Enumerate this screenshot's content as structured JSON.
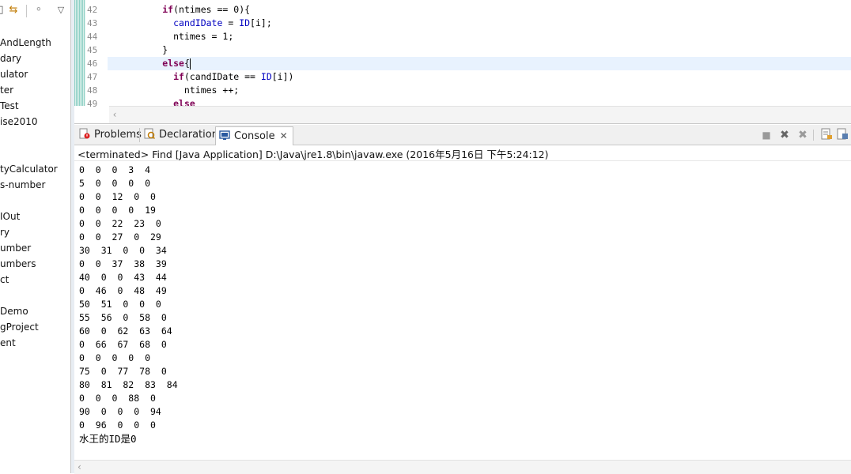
{
  "left_panel": {
    "toolbar_icons": [
      "link-with-editor-icon",
      "sync-arrows-icon",
      "filter-icon",
      "view-menu-icon"
    ],
    "items": [
      "AndLength",
      "dary",
      "ulator",
      "ter",
      "Test",
      "ise2010",
      "",
      "",
      "tyCalculator",
      "s-number",
      "",
      "IOut",
      "ry",
      "umber",
      "umbers",
      "ct",
      "",
      "Demo",
      "gProject",
      "ent"
    ]
  },
  "editor": {
    "line_numbers": [
      "42",
      "43",
      "44",
      "45",
      "46",
      "47",
      "48",
      "49"
    ]
  },
  "tabs": {
    "problems": "Problems",
    "declaration": "Declaration",
    "console": "Console"
  },
  "console": {
    "title": "<terminated> Find [Java Application] D:\\Java\\jre1.8\\bin\\javaw.exe (2016年5月16日 下午5:24:12)",
    "lines": [
      "0  0  0  3  4",
      "5  0  0  0  0",
      "0  0  12  0  0",
      "0  0  0  0  19",
      "0  0  22  23  0",
      "0  0  27  0  29",
      "30  31  0  0  34",
      "0  0  37  38  39",
      "40  0  0  43  44",
      "0  46  0  48  49",
      "50  51  0  0  0",
      "55  56  0  58  0",
      "60  0  62  63  64",
      "0  66  67  68  0",
      "0  0  0  0  0",
      "75  0  77  78  0",
      "80  81  82  83  84",
      "0  0  0  88  0",
      "90  0  0  0  94",
      "0  96  0  0  0"
    ],
    "result": "水王的ID是0"
  },
  "colors": {
    "keyword": "#7f0055",
    "field": "#0000c0",
    "current_line": "#e8f2fe"
  }
}
